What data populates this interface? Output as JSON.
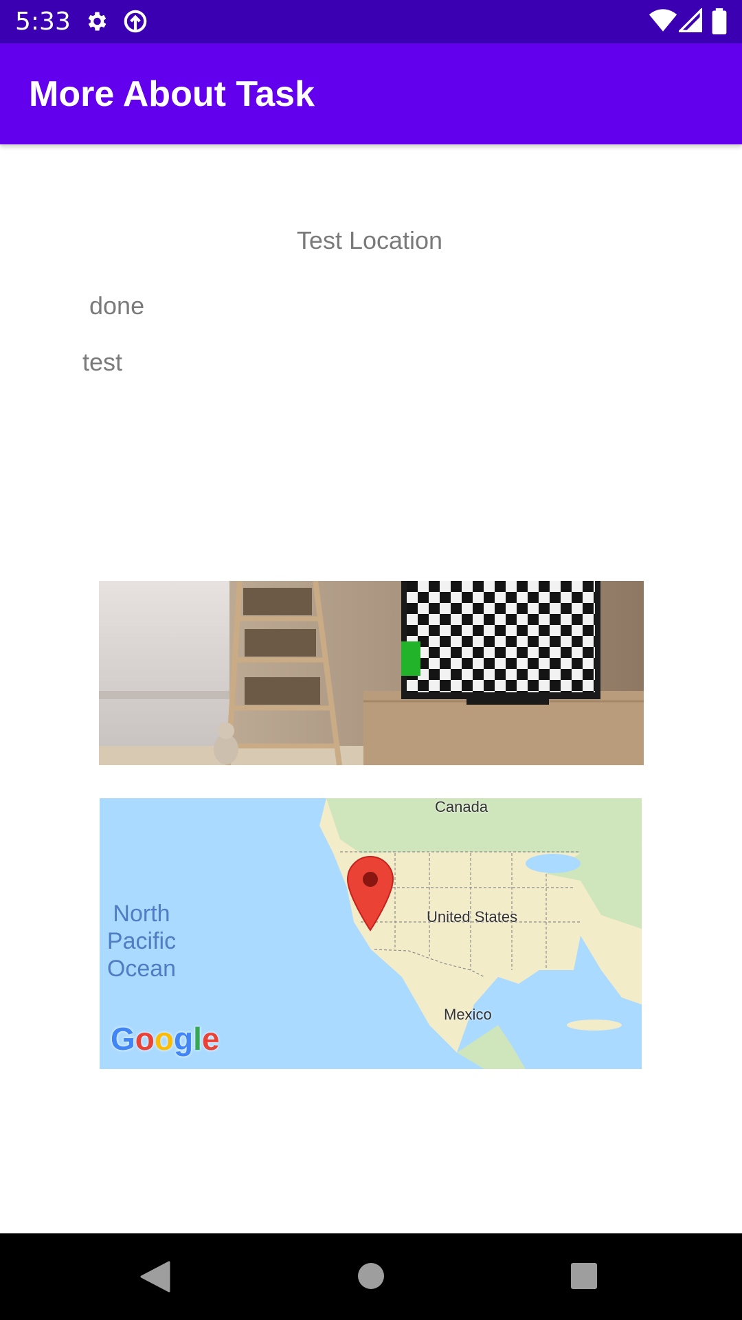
{
  "status_bar": {
    "time": "5:33",
    "icons": [
      "gear-icon",
      "sync-icon",
      "wifi-icon",
      "signal-icon",
      "battery-icon"
    ],
    "color": "#3a00b2"
  },
  "app_bar": {
    "title": "More About Task",
    "color": "#6200ee"
  },
  "task": {
    "location": "Test Location",
    "status": "done",
    "description": "test"
  },
  "map": {
    "labels": {
      "canada": "Canada",
      "usa": "United States",
      "mexico": "Mexico",
      "ocean": "North Pacific Ocean",
      "brand": "Google"
    },
    "marker_icon": "map-pin-icon"
  },
  "nav_bar": {
    "buttons": [
      "back-icon",
      "home-icon",
      "recents-icon"
    ]
  }
}
